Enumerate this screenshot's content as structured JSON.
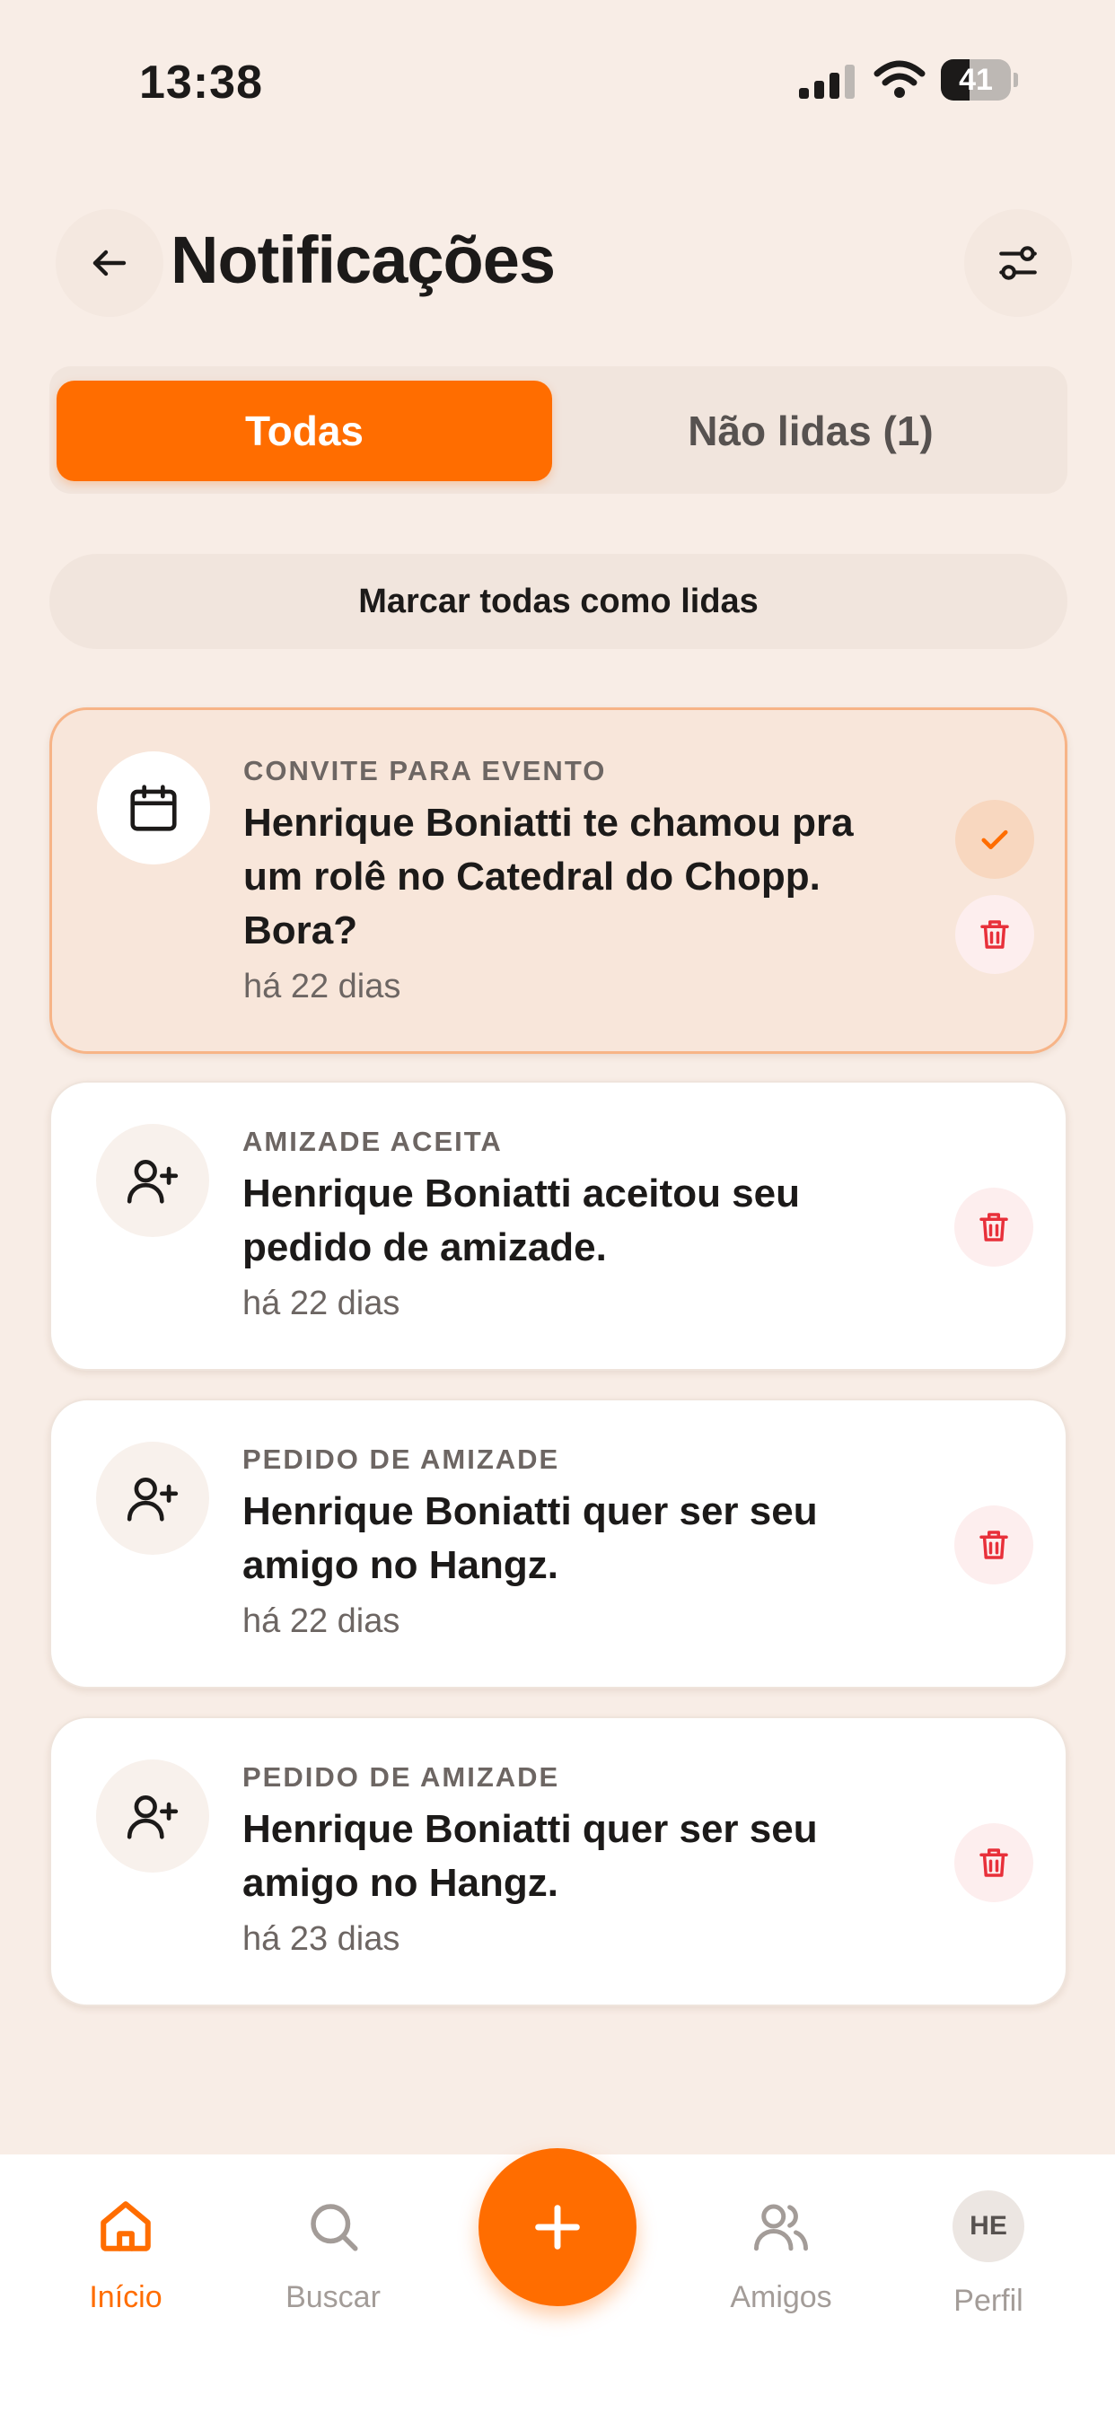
{
  "status_bar": {
    "time": "13:38",
    "battery_level": "41",
    "battery_fraction": 0.41,
    "icons": [
      "signal-icon",
      "wifi-icon",
      "battery-icon"
    ]
  },
  "header": {
    "title": "Notificações",
    "back_icon": "arrow-left-icon",
    "filter_icon": "sliders-icon"
  },
  "tabs": [
    {
      "label": "Todas",
      "active": true
    },
    {
      "label": "Não lidas (1)",
      "active": false
    }
  ],
  "mark_all_label": "Marcar todas como lidas",
  "notifications": [
    {
      "category": "CONVITE PARA EVENTO",
      "message": "Henrique Boniatti te chamou pra um rolê no Catedral do Chopp. Bora?",
      "time": "há 22 dias",
      "icon": "calendar-icon",
      "unread": true
    },
    {
      "category": "AMIZADE ACEITA",
      "message": "Henrique Boniatti aceitou seu pedido de amizade.",
      "time": "há 22 dias",
      "icon": "user-plus-icon",
      "unread": false
    },
    {
      "category": "PEDIDO DE AMIZADE",
      "message": "Henrique Boniatti quer ser seu amigo no Hangz.",
      "time": "há 22 dias",
      "icon": "user-plus-icon",
      "unread": false
    },
    {
      "category": "PEDIDO DE AMIZADE",
      "message": "Henrique Boniatti quer ser seu amigo no Hangz.",
      "time": "há 23 dias",
      "icon": "user-plus-icon",
      "unread": false
    }
  ],
  "bottom_nav": {
    "items": [
      {
        "label": "Início",
        "icon": "home-icon",
        "active": true
      },
      {
        "label": "Buscar",
        "icon": "search-icon",
        "active": false
      },
      {
        "label": "Amigos",
        "icon": "users-icon",
        "active": false
      },
      {
        "label": "Perfil",
        "icon": "avatar",
        "active": false
      }
    ],
    "avatar_initials": "HE",
    "fab_icon": "plus-icon"
  },
  "colors": {
    "accent": "#ff6d00",
    "background": "#f8ede6",
    "unread_card": "#f8e6da",
    "delete": "#e8303a"
  }
}
